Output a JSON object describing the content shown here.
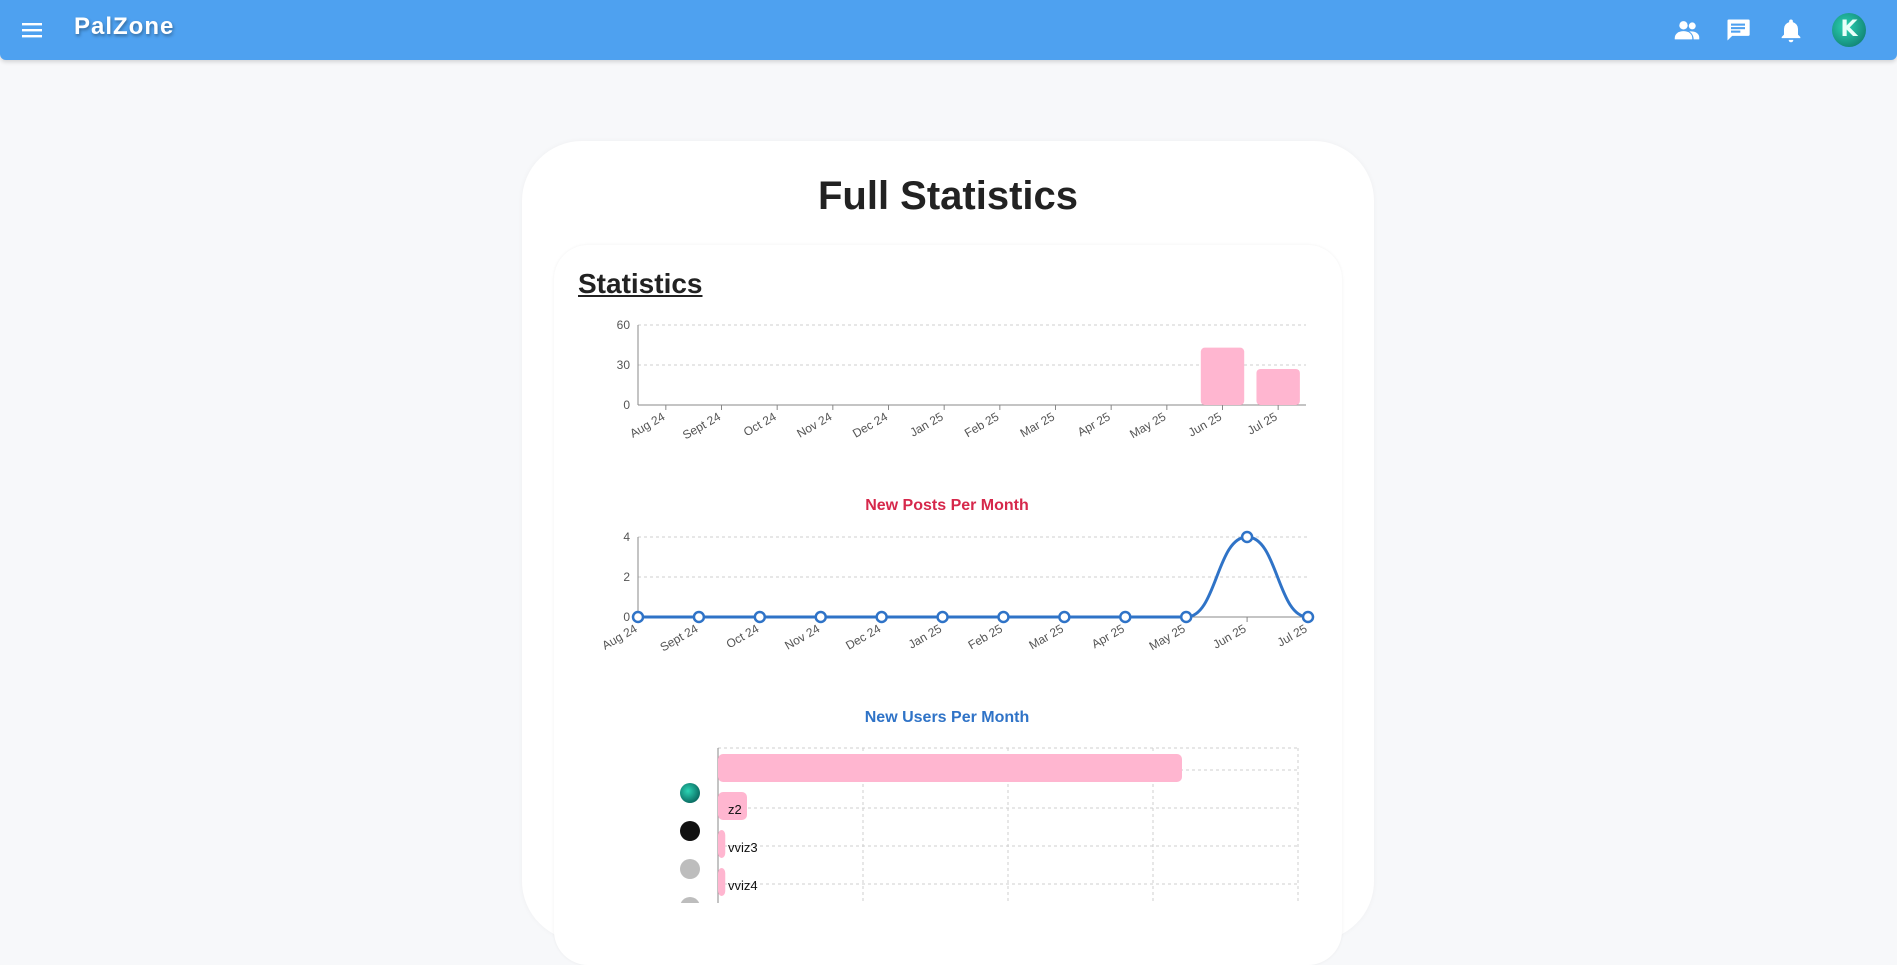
{
  "header": {
    "brand": "PalZone",
    "icons": [
      "menu-icon",
      "people-icon",
      "chat-icon",
      "bell-icon"
    ],
    "avatar_letter": "K",
    "accent": "#4ea1f0"
  },
  "page": {
    "title": "Full Statistics",
    "section_heading": "Statistics"
  },
  "chart_data": [
    {
      "type": "bar",
      "title": "",
      "categories": [
        "Aug 24",
        "Sept 24",
        "Oct 24",
        "Nov 24",
        "Dec 24",
        "Jan 25",
        "Feb 25",
        "Mar 25",
        "Apr 25",
        "May 25",
        "Jun 25",
        "Jul 25"
      ],
      "values": [
        0,
        0,
        0,
        0,
        0,
        0,
        0,
        0,
        0,
        0,
        43,
        27
      ],
      "yticks": [
        0,
        30,
        60
      ],
      "ylim": [
        0,
        60
      ],
      "color": "#ffb6d0",
      "grid": true
    },
    {
      "type": "line",
      "title": "New Posts Per Month",
      "title_color": "#d6284b",
      "categories": [
        "Aug 24",
        "Sept 24",
        "Oct 24",
        "Nov 24",
        "Dec 24",
        "Jan 25",
        "Feb 25",
        "Mar 25",
        "Apr 25",
        "May 25",
        "Jun 25",
        "Jul 25"
      ],
      "values": [
        0,
        0,
        0,
        0,
        0,
        0,
        0,
        0,
        0,
        0,
        4,
        0
      ],
      "yticks": [
        0,
        2,
        4
      ],
      "ylim": [
        0,
        4
      ],
      "color": "#2f73c7",
      "grid": true
    },
    {
      "type": "bar",
      "orientation": "horizontal",
      "title": "New Users Per Month",
      "title_color": "#2f73c7",
      "categories": [
        "",
        "z2",
        "vviz3",
        "vviz4"
      ],
      "values": [
        32,
        2,
        0.5,
        0.5
      ],
      "xlim": [
        0,
        40
      ],
      "color": "#ffb6d0",
      "grid": true
    }
  ]
}
